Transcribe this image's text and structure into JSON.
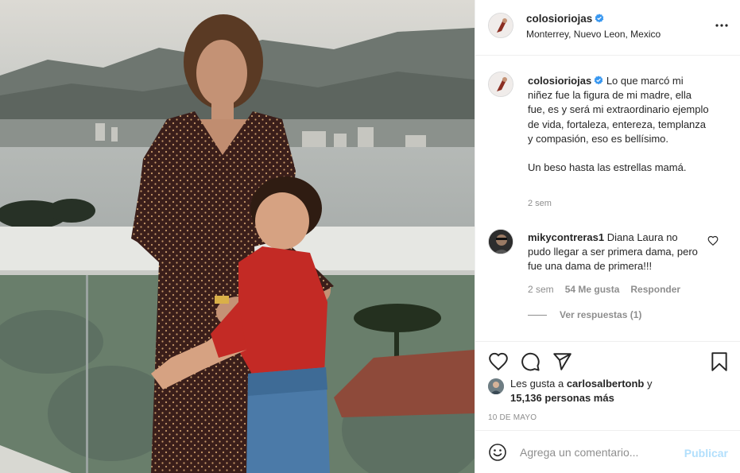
{
  "post": {
    "photo_alt": "",
    "author": {
      "username": "colosioriojas",
      "verified": true,
      "location": "Monterrey, Nuevo Leon, Mexico"
    },
    "caption": {
      "username": "colosioriojas",
      "text": "Lo que marcó mi niñez fue la figura de mi madre, ella fue, es y será mi extraordinario ejemplo de vida, fortaleza, entereza, templanza y compasión, eso es bellísimo.\n\nUn beso hasta las estrellas mamá.",
      "time": "2 sem"
    },
    "comments": [
      {
        "username": "mikycontreras1",
        "text": "Diana Laura no pudo llegar a ser primera dama, pero fue una dama de primera!!!",
        "time": "2 sem",
        "likes": "54 Me gusta",
        "reply_label": "Responder",
        "view_replies": "Ver respuestas (1)"
      }
    ],
    "likes": {
      "prefix": "Les gusta a ",
      "first_user": "carlosalbertonb",
      "connector": " y",
      "others": "15,136 personas más"
    },
    "date": "10 DE MAYO",
    "comment_box": {
      "placeholder": "Agrega un comentario...",
      "publish_label": "Publicar"
    },
    "icons": {
      "like": "heart-icon",
      "comment": "comment-icon",
      "share": "share-icon",
      "save": "bookmark-icon",
      "more": "more-options-icon",
      "emoji": "emoji-icon",
      "verified": "verified-badge-icon"
    },
    "colors": {
      "verified": "#3897f0",
      "publish_disabled": "#b2dffc",
      "meta_text": "#8e8e8e",
      "text": "#262626"
    }
  }
}
